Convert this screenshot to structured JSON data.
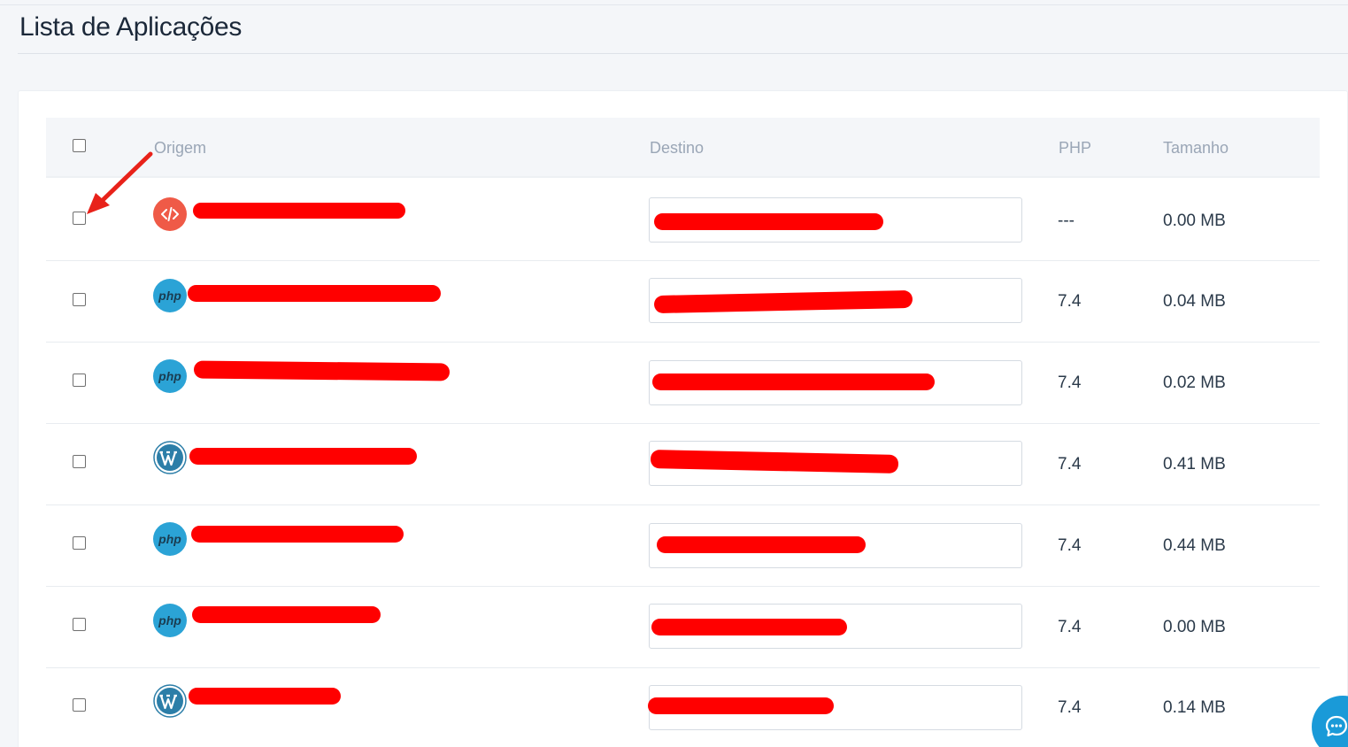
{
  "page": {
    "title": "Lista de Aplicações"
  },
  "table": {
    "headers": {
      "origem": "Origem",
      "destino": "Destino",
      "php": "PHP",
      "tamanho": "Tamanho"
    },
    "rows": [
      {
        "type": "custom",
        "icon": "code-icon",
        "php": "---",
        "size": "0.00 MB"
      },
      {
        "type": "php",
        "icon": "php-icon",
        "icon_label": "php",
        "php": "7.4",
        "size": "0.04 MB"
      },
      {
        "type": "php",
        "icon": "php-icon",
        "icon_label": "php",
        "php": "7.4",
        "size": "0.02 MB"
      },
      {
        "type": "wordpress",
        "icon": "wordpress-icon",
        "php": "7.4",
        "size": "0.41 MB"
      },
      {
        "type": "php",
        "icon": "php-icon",
        "icon_label": "php",
        "php": "7.4",
        "size": "0.44 MB"
      },
      {
        "type": "php",
        "icon": "php-icon",
        "icon_label": "php",
        "php": "7.4",
        "size": "0.00 MB"
      },
      {
        "type": "wordpress",
        "icon": "wordpress-icon",
        "php": "7.4",
        "size": "0.14 MB"
      }
    ]
  },
  "colors": {
    "redaction": "#ff0000",
    "php_icon": "#2ba3d6",
    "code_icon": "#ef5a47",
    "chat_button": "#1a9ad8",
    "arrow": "#e8221a"
  }
}
